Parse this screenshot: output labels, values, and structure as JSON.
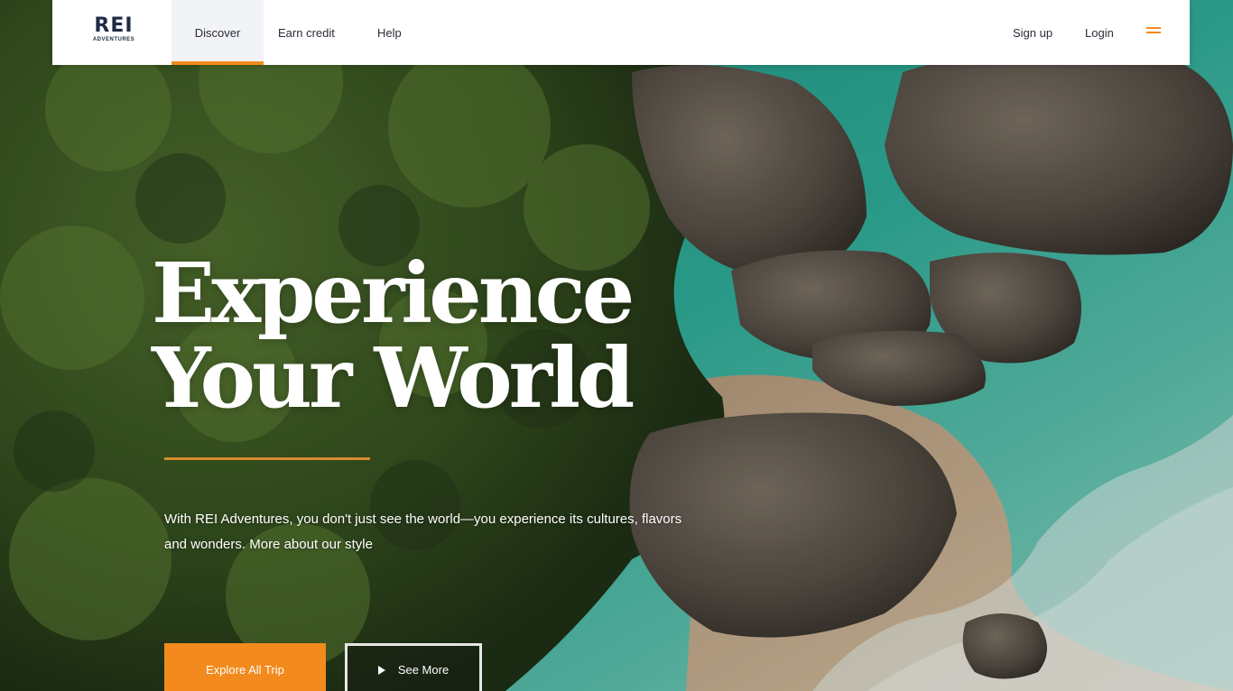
{
  "brand": {
    "logo_main": "REI",
    "logo_sub": "ADVENTURES",
    "accent_color": "#f28a1e",
    "nav_text_color": "#2b2b3a"
  },
  "nav": {
    "items": [
      {
        "label": "Discover",
        "active": true
      },
      {
        "label": "Earn credit",
        "active": false
      },
      {
        "label": "Help",
        "active": false
      }
    ],
    "signup_label": "Sign up",
    "login_label": "Login",
    "menu_icon": "hamburger-menu-icon"
  },
  "hero": {
    "headline_line1": "Experience",
    "headline_line2": "Your World",
    "subtext": "With REI Adventures, you don't just see the world—you experience its cultures, flavors and wonders. More about our style",
    "explore_label": "Explore All Trip",
    "more_label": "See More",
    "play_icon": "play-icon"
  }
}
